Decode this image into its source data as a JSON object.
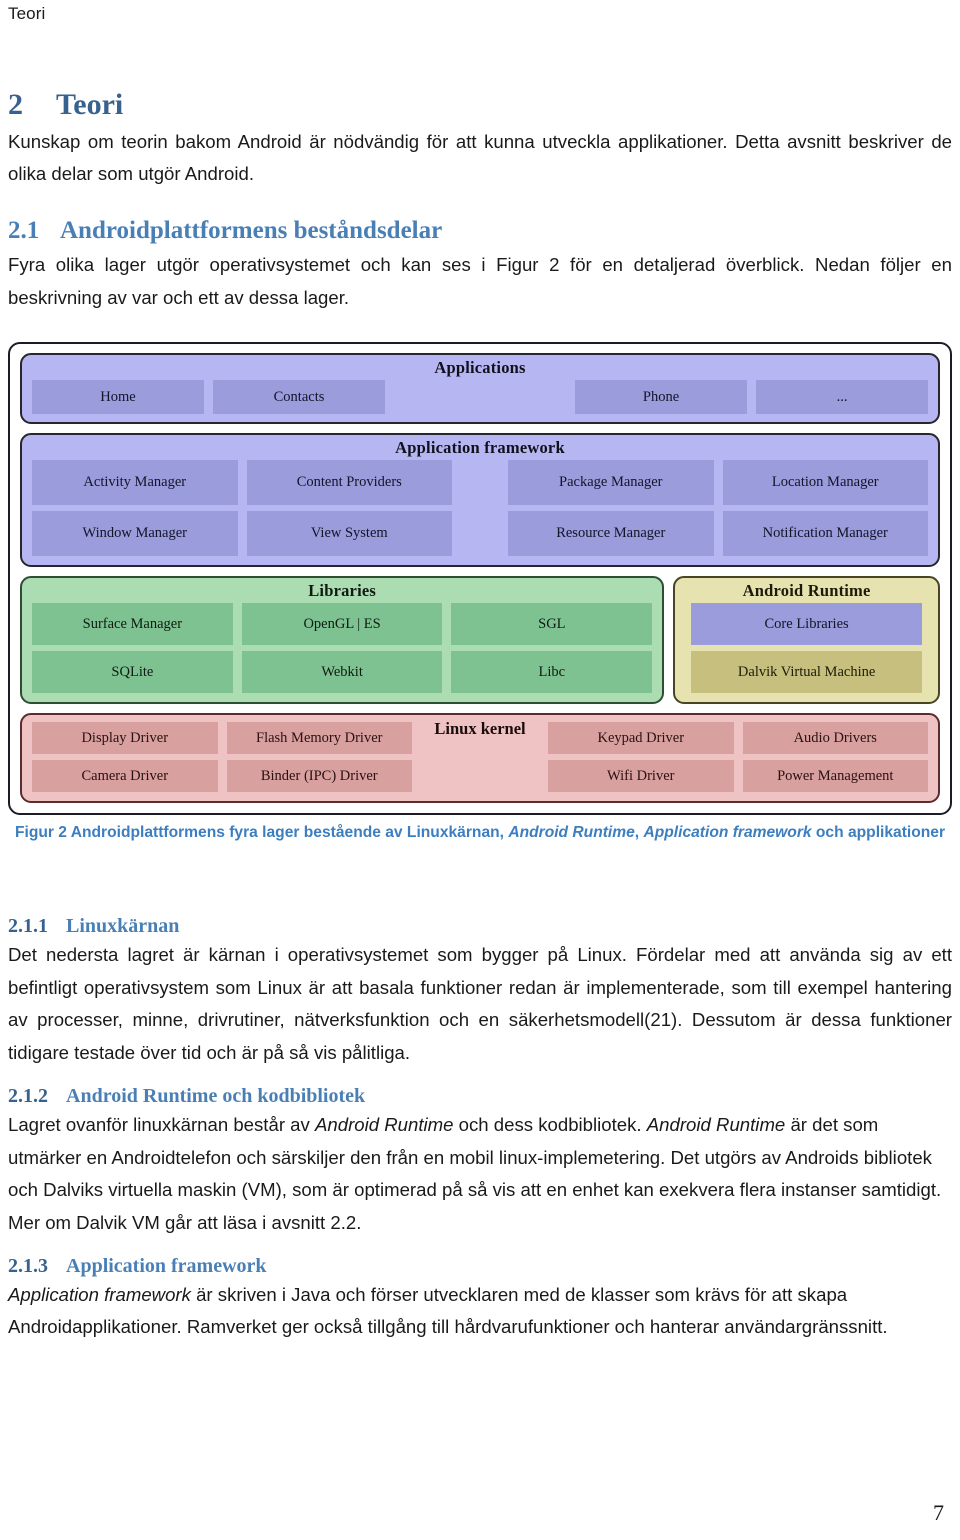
{
  "header": {
    "running_head": "Teori"
  },
  "sections": {
    "s2": {
      "number": "2",
      "title": "Teori",
      "paragraph": "Kunskap om teorin bakom Android är nödvändig för att kunna utveckla applikationer. Detta avsnitt beskriver de olika delar som utgör Android."
    },
    "s21": {
      "number": "2.1",
      "title": "Androidplattformens beståndsdelar",
      "paragraph": "Fyra olika lager utgör operativsystemet och kan ses i Figur 2 för en detaljerad överblick. Nedan följer en beskrivning av var och ett av dessa lager."
    },
    "s211": {
      "number": "2.1.1",
      "title": "Linuxkärnan",
      "paragraph": "Det nedersta lagret är kärnan i operativsystemet som bygger på Linux. Fördelar med att använda sig av ett befintligt operativsystem som Linux är att basala funktioner redan är implementerade, som till exempel hantering av processer, minne, drivrutiner, nätverksfunktion och en säkerhetsmodell(21). Dessutom är dessa funktioner tidigare testade över tid och är på så vis pålitliga."
    },
    "s212": {
      "number": "2.1.2",
      "title": "Android Runtime och kodbibliotek",
      "para_part1": "Lagret ovanför linuxkärnan består av ",
      "em1": "Android Runtime",
      "para_part2": " och dess kodbibliotek. ",
      "em2": "Android Runtime",
      "para_part3": " är det som utmärker en Androidtelefon och särskiljer den från en mobil linux-implemetering. Det utgörs av Androids bibliotek och Dalviks virtuella maskin (VM), som är optimerad på så vis att en enhet kan exekvera flera instanser samtidigt. Mer om Dalvik VM går att läsa i avsnitt 2.2."
    },
    "s213": {
      "number": "2.1.3",
      "title": "Application framework",
      "em1": "Application framework",
      "para_part1": " är skriven i Java och förser utvecklaren med de klasser som krävs för att skapa Androidapplikationer. Ramverket ger också tillgång till hårdvarufunktioner och hanterar användargränssnitt."
    }
  },
  "figure": {
    "caption_part1": "Figur 2 Androidplattformens fyra lager bestående av Linuxkärnan, ",
    "caption_em1": "Android Runtime",
    "caption_part2": ", ",
    "caption_em2": "Application framework",
    "caption_part3": " och applikationer",
    "colors": {
      "applications_bg": "#b6b7f2",
      "applications_cell": "#9a9cdb",
      "libraries_bg": "#abdcb2",
      "libraries_cell": "#7fc291",
      "runtime_bg": "#e6e3b0",
      "runtime_cell": "#c6bf7e",
      "kernel_bg": "#efc3c3",
      "kernel_cell": "#d9a0a0",
      "caption": "#3c7ebf"
    },
    "layers": {
      "applications": {
        "title": "Applications",
        "cells": [
          "Home",
          "Contacts",
          "Phone",
          "..."
        ]
      },
      "framework": {
        "title": "Application framework",
        "row1": [
          "Activity Manager",
          "Content Providers",
          "Package Manager",
          "Location Manager"
        ],
        "row2": [
          "Window Manager",
          "View System",
          "Resource Manager",
          "Notification Manager"
        ]
      },
      "libraries": {
        "title": "Libraries",
        "row1": [
          "Surface Manager",
          "OpenGL | ES",
          "SGL"
        ],
        "row2": [
          "SQLite",
          "Webkit",
          "Libc"
        ]
      },
      "runtime": {
        "title": "Android Runtime",
        "cells": [
          "Core Libraries",
          "Dalvik Virtual Machine"
        ]
      },
      "kernel": {
        "title": "Linux kernel",
        "row1": [
          "Display Driver",
          "Flash Memory Driver",
          "Keypad Driver",
          "Audio Drivers"
        ],
        "row2": [
          "Camera Driver",
          "Binder (IPC) Driver",
          "Wifi Driver",
          "Power Management"
        ]
      }
    }
  },
  "footer": {
    "page_number": "7"
  }
}
